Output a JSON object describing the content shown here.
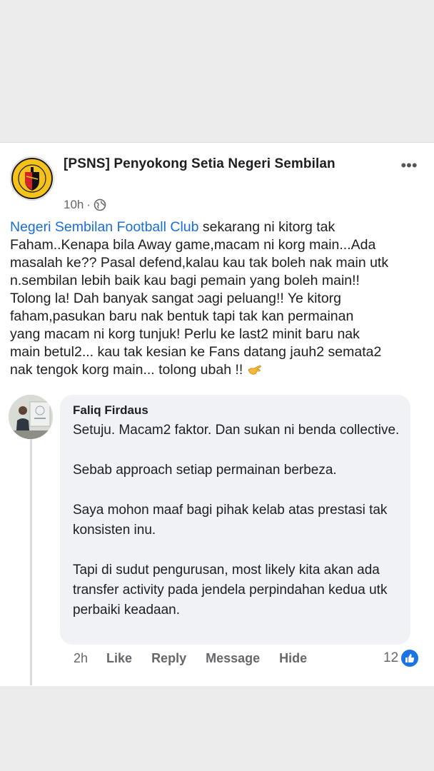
{
  "post": {
    "page_name": "[PSNS] Penyokong Setia Negeri Sembilan",
    "time": "10h",
    "dot": "·",
    "mention": "Negeri Sembilan Football Club",
    "text": " sekarang ni kitorg tak\nFaham..Kenapa bila Away game,macam ni korg main...Ada\nmasalah ke?? Pasal defend,kalau kau tak boleh nak main utk\nn.sembilan lebih baik kau bagi pemain yang boleh main!!\nTolong la! Dah banyak sangat ↄagi peluang!! Ye kitorg\nfaham,pasukan baru nak bentuk tapi tak kan permainan\nyang macam ni korg tunjuk! Perlu ke last2 minit baru nak\nmain betul2... kau tak kesian ke Fans datang jauh2 semata2\nnak tengok korg main... tolong ubah !!",
    "emoji": "pointing-hand-emoji"
  },
  "comment": {
    "author": "Faliq Firdaus",
    "paragraphs": [
      "Setuju. Macam2 faktor. Dan sukan ni benda collective.",
      "Sebab approach setiap permainan berbeza.",
      "Saya mohon maaf bagi pihak kelab atas prestasi tak konsisten inu.",
      "Tapi di sudut pengurusan, most likely kita akan ada transfer activity pada jendela perpindahan kedua utk perbaiki keadaan."
    ],
    "time": "2h",
    "actions": {
      "like": "Like",
      "reply": "Reply",
      "message": "Message",
      "hide": "Hide"
    },
    "reaction_count": "12",
    "reaction_icon": "thumbs-up-icon"
  },
  "colors": {
    "link_blue": "#1a6fd6",
    "like_blue": "#1b74e4",
    "muted_text": "#65676b",
    "bubble": "#f0f2f5"
  }
}
